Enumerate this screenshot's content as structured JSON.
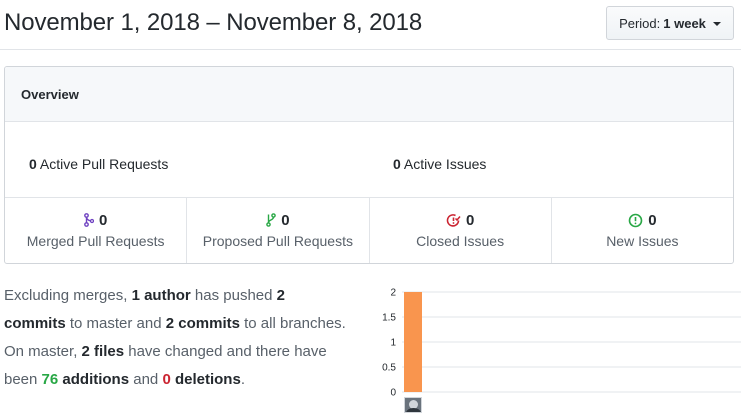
{
  "header": {
    "date_range": "November 1, 2018 – November 8, 2018",
    "period_label": "Period:",
    "period_value": "1 week"
  },
  "overview": {
    "title": "Overview",
    "active_prs": {
      "count": "0",
      "label": "Active Pull Requests"
    },
    "active_issues": {
      "count": "0",
      "label": "Active Issues"
    },
    "stats": [
      {
        "count": "0",
        "label": "Merged Pull Requests",
        "icon": "merge-icon",
        "color": "#6f42c1"
      },
      {
        "count": "0",
        "label": "Proposed Pull Requests",
        "icon": "pull-request-icon",
        "color": "#28a745"
      },
      {
        "count": "0",
        "label": "Closed Issues",
        "icon": "issue-closed-icon",
        "color": "#cb2431"
      },
      {
        "count": "0",
        "label": "New Issues",
        "icon": "issue-opened-icon",
        "color": "#28a745"
      }
    ]
  },
  "summary": {
    "t1": "Excluding merges, ",
    "authors": "1 author",
    "t2": " has pushed ",
    "commits_master": "2 commits",
    "t3": " to master and ",
    "commits_all": "2 commits",
    "t4": " to all branches. On master, ",
    "files": "2 files",
    "t5": " have changed and there have been ",
    "additions": "76",
    "t6": " additions",
    "t7": " and ",
    "deletions": "0",
    "t8": " deletions",
    "t9": "."
  },
  "chart_data": {
    "type": "bar",
    "categories": [
      "author-1"
    ],
    "values": [
      2
    ],
    "ylim": [
      0,
      2
    ],
    "yticks": [
      "0",
      "0.5",
      "1",
      "1.5",
      "2"
    ],
    "grid": true,
    "bar_color": "#f9954e"
  }
}
